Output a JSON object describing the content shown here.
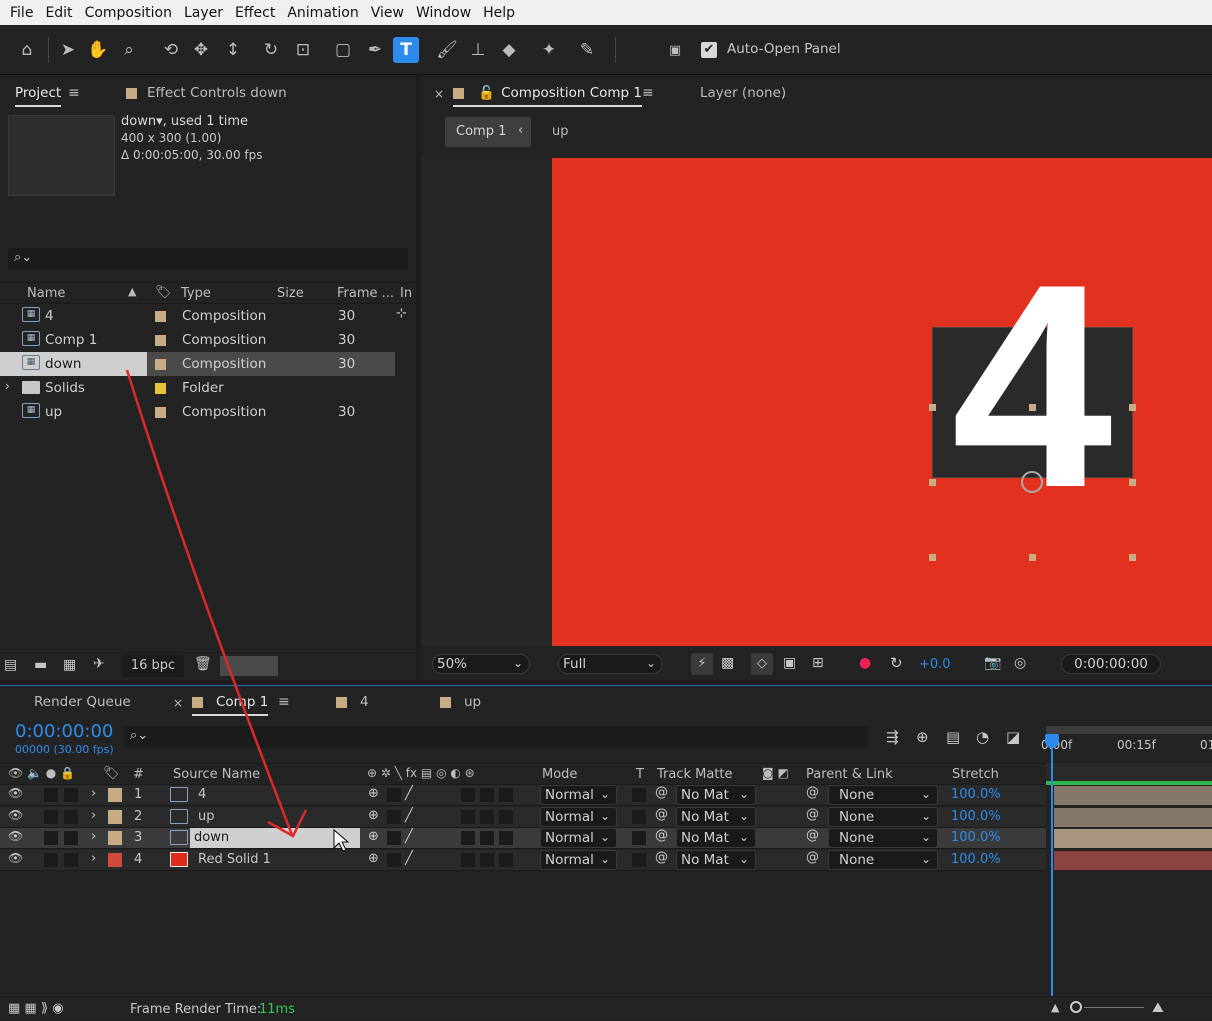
{
  "menu": [
    "File",
    "Edit",
    "Composition",
    "Layer",
    "Effect",
    "Animation",
    "View",
    "Window",
    "Help"
  ],
  "toolbar": {
    "auto_open_label": "Auto-Open Panel",
    "auto_open_checked": true
  },
  "project_panel": {
    "tabs": [
      "Project",
      "Effect Controls down"
    ],
    "preview_info": {
      "name": "down",
      "used": ", used 1 time",
      "size": "400 x 300 (1.00)",
      "duration": "Δ 0:00:05:00, 30.00 fps"
    },
    "search_placeholder": "",
    "columns": [
      "Name",
      "Type",
      "Size",
      "Frame ...",
      "In"
    ],
    "items": [
      {
        "name": "4",
        "type": "Composition",
        "size": "",
        "frame": "30",
        "color": "#c8ac84"
      },
      {
        "name": "Comp 1",
        "type": "Composition",
        "size": "",
        "frame": "30",
        "color": "#c8ac84"
      },
      {
        "name": "down",
        "type": "Composition",
        "size": "",
        "frame": "30",
        "color": "#c8ac84",
        "selected": true
      },
      {
        "name": "Solids",
        "type": "Folder",
        "size": "",
        "frame": "",
        "color": "#e6c33a"
      },
      {
        "name": "up",
        "type": "Composition",
        "size": "",
        "frame": "30",
        "color": "#c8ac84"
      }
    ],
    "bpc": "16 bpc"
  },
  "comp_panel": {
    "tabs": [
      "Composition Comp 1",
      "Layer (none)"
    ],
    "breadcrumbs": [
      "Comp 1",
      "up"
    ],
    "digit": "4",
    "zoom": "50%",
    "resolution": "Full",
    "exposure": "+0.0",
    "timecode": "0:00:00:00",
    "bg_color": "#e2321f"
  },
  "timeline": {
    "tabs": [
      "Render Queue",
      "Comp 1",
      "4",
      "up"
    ],
    "timecode": "0:00:00:00",
    "frames": "00000 (30.00 fps)",
    "columns": {
      "num": "#",
      "source": "Source Name",
      "mode": "Mode",
      "t": "T",
      "track_matte": "Track Matte",
      "parent": "Parent & Link",
      "stretch": "Stretch"
    },
    "ruler": [
      "0:00f",
      "00:15f",
      "01"
    ],
    "layers": [
      {
        "num": "1",
        "name": "4",
        "mode": "Normal",
        "matte": "No Mat",
        "parent": "None",
        "stretch": "100.0%",
        "label": "#c8ac84",
        "bar": "#857868"
      },
      {
        "num": "2",
        "name": "up",
        "mode": "Normal",
        "matte": "No Mat",
        "parent": "None",
        "stretch": "100.0%",
        "label": "#c8ac84",
        "bar": "#857868"
      },
      {
        "num": "3",
        "name": "down",
        "mode": "Normal",
        "matte": "No Mat",
        "parent": "None",
        "stretch": "100.0%",
        "label": "#c8ac84",
        "bar": "#a8977e",
        "selected": true
      },
      {
        "num": "4",
        "name": "Red Solid 1",
        "mode": "Normal",
        "matte": "No Mat",
        "parent": "None",
        "stretch": "100.0%",
        "label": "#d24a3c",
        "bar": "#8c4440"
      }
    ],
    "render_time_label": "Frame Render Time:",
    "render_time_value": "11ms"
  },
  "colors": {
    "accent": "#2d8ceb",
    "annotation_arrow": "#e0282a"
  }
}
